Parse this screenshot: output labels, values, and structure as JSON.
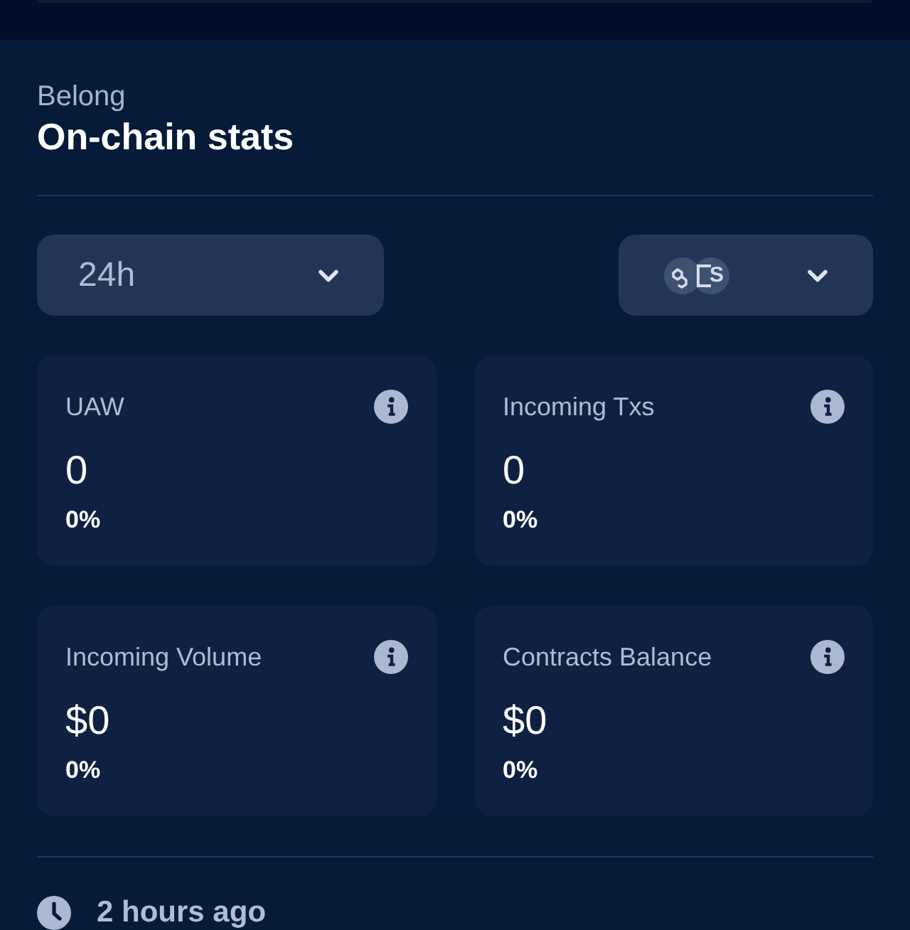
{
  "header": {
    "project": "Belong",
    "title": "On-chain stats"
  },
  "filters": [
    {
      "kind": "period",
      "value": "24h"
    },
    {
      "kind": "chains",
      "icons": [
        {
          "kind": "link"
        },
        {
          "kind": "letter",
          "text": "S"
        }
      ]
    }
  ],
  "stats": [
    {
      "label": "UAW",
      "value": "0",
      "change": "0%"
    },
    {
      "label": "Incoming Txs",
      "value": "0",
      "change": "0%"
    },
    {
      "label": "Incoming Volume",
      "value": "$0",
      "change": "0%"
    },
    {
      "label": "Contracts Balance",
      "value": "$0",
      "change": "0%"
    }
  ],
  "updated": "2 hours ago"
}
